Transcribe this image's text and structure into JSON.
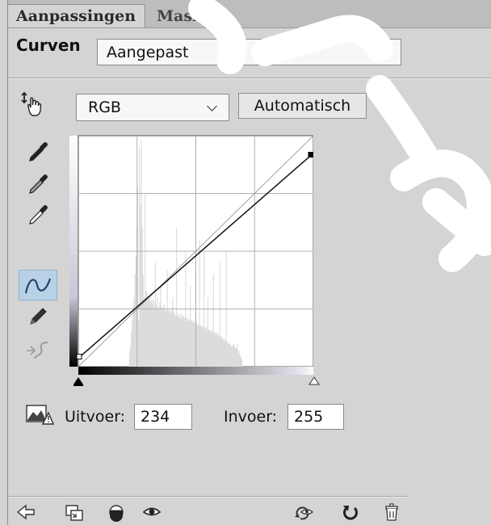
{
  "tabs": [
    {
      "label": "Aanpassingen",
      "active": true
    },
    {
      "label": "Maskers",
      "active": false
    }
  ],
  "preset": {
    "label": "Curven",
    "value": "Aangepast"
  },
  "channel": {
    "value": "RGB",
    "auto_label": "Automatisch"
  },
  "tools": {
    "icons": [
      "hand-target-icon",
      "black-point-eyedropper-icon",
      "gray-point-eyedropper-icon",
      "white-point-eyedropper-icon",
      "curve-point-tool-icon",
      "pencil-draw-icon",
      "smooth-curve-icon"
    ]
  },
  "curve": {
    "input_range": [
      0,
      255
    ],
    "output_range": [
      0,
      255
    ],
    "points": [
      [
        0,
        11
      ],
      [
        255,
        234
      ]
    ]
  },
  "output": {
    "label": "Uitvoer:",
    "value": "234"
  },
  "input": {
    "label": "Invoer:",
    "value": "255"
  },
  "bottom_toolbar": {
    "icons": [
      "back-arrow-icon",
      "clip-to-layer-icon",
      "layer-visibility-icon",
      "eye-icon",
      "view-previous-icon",
      "reset-icon",
      "trash-icon"
    ]
  },
  "colors": {
    "panel_bg": "#d4d4d4",
    "selected_tool_bg": "#b9d1e6"
  }
}
